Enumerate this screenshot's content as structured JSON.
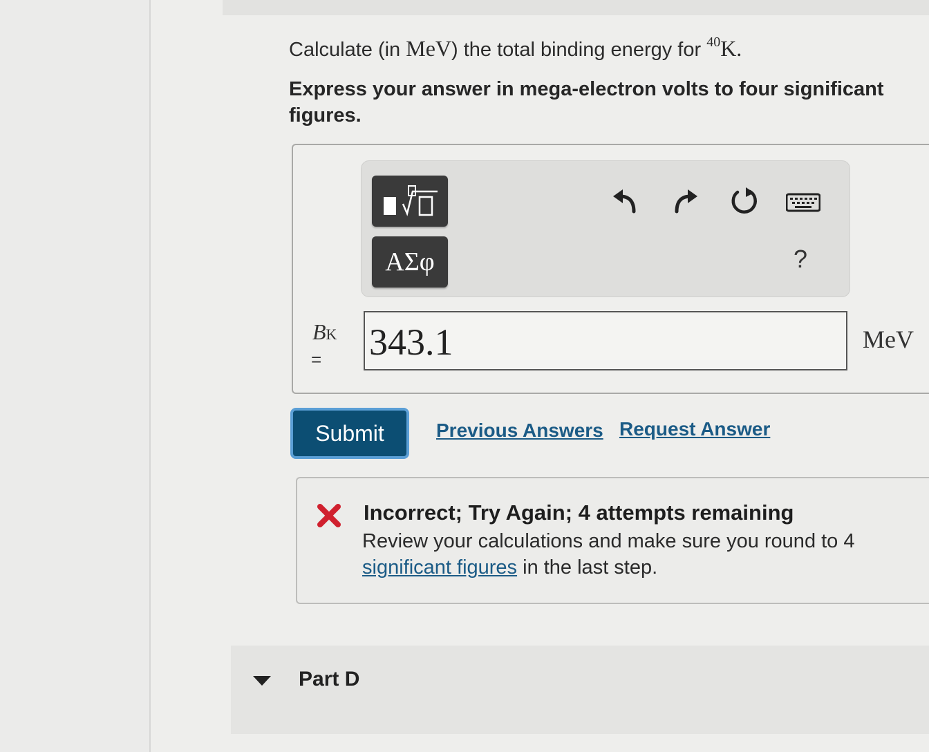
{
  "question": {
    "prefix": "Calculate (in ",
    "unit_math": "MeV",
    "middle": ") the total binding energy for ",
    "mass_number": "40",
    "element": "K",
    "suffix": "."
  },
  "instruction": "Express your answer in mega-electron volts to four significant figures.",
  "toolbar": {
    "greek_label": "ΑΣφ",
    "help_label": "?"
  },
  "answer": {
    "variable": "B",
    "variable_sub": "K",
    "equals": "=",
    "value": "343.1",
    "unit": "MeV"
  },
  "actions": {
    "submit_label": "Submit",
    "previous_answers": "Previous Answers",
    "request_answer": "Request Answer"
  },
  "feedback": {
    "title": "Incorrect; Try Again; 4 attempts remaining",
    "text_before": "Review your calculations and make sure you round to 4 ",
    "link_text": "significant figures",
    "text_after": " in the last step.",
    "icon_color": "#d0202e"
  },
  "next_part": {
    "label": "Part D"
  },
  "colors": {
    "submit_bg": "#0c4e73",
    "link": "#1b5b86"
  }
}
